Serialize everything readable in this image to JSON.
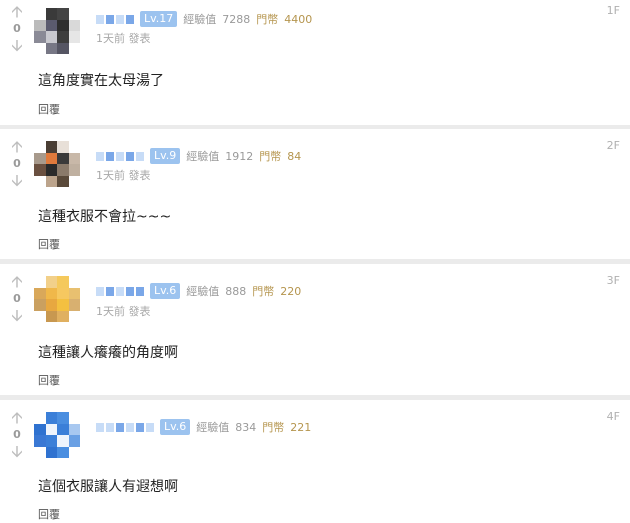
{
  "comments": [
    {
      "floor": "1F",
      "votes": "0",
      "level": "Lv.17",
      "exp_label": "經驗值",
      "exp": "7288",
      "coin_label": "門幣",
      "coins": "4400",
      "time": "1天前 發表",
      "text": "這角度實在太母湯了",
      "reply": "回覆",
      "avatar_colors": [
        "#ffffff",
        "#3a3a3a",
        "#444444",
        "#ffffff",
        "#bbbbbb",
        "#5b5b6e",
        "#2e2e2e",
        "#d9d9d9",
        "#8a8a96",
        "#c9c9cf",
        "#3d3d3d",
        "#e6e6e6",
        "#ffffff",
        "#777785",
        "#555563",
        "#ffffff"
      ]
    },
    {
      "floor": "2F",
      "votes": "0",
      "level": "Lv.9",
      "exp_label": "經驗值",
      "exp": "1912",
      "coin_label": "門幣",
      "coins": "84",
      "time": "1天前 發表",
      "text": "這種衣服不會拉~~~",
      "reply": "回覆",
      "avatar_colors": [
        "#ffffff",
        "#4a3e34",
        "#e8e0d8",
        "#ffffff",
        "#a89a8c",
        "#e07a3c",
        "#3a3a3a",
        "#c8b8a8",
        "#6a5040",
        "#2a2a2a",
        "#8a7a6a",
        "#bfb0a0",
        "#ffffff",
        "#bca48c",
        "#5a4a3a",
        "#ffffff"
      ]
    },
    {
      "floor": "3F",
      "votes": "0",
      "level": "Lv.6",
      "exp_label": "經驗值",
      "exp": "888",
      "coin_label": "門幣",
      "coins": "220",
      "time": "1天前 發表",
      "text": "這種讓人癢癢的角度啊",
      "reply": "回覆",
      "avatar_colors": [
        "#ffffff",
        "#f2d08a",
        "#f5c95c",
        "#ffffff",
        "#d9a85a",
        "#f0b84a",
        "#f6c860",
        "#e8c070",
        "#caa060",
        "#e8a840",
        "#f4c040",
        "#d8b070",
        "#ffffff",
        "#c89850",
        "#e0b060",
        "#ffffff"
      ]
    },
    {
      "floor": "4F",
      "votes": "0",
      "level": "Lv.6",
      "exp_label": "經驗值",
      "exp": "834",
      "coin_label": "門幣",
      "coins": "221",
      "time": "",
      "text": "這個衣服讓人有遐想啊",
      "reply": "回覆",
      "avatar_colors": [
        "#ffffff",
        "#3b7fd8",
        "#4a8ee0",
        "#ffffff",
        "#2f72d0",
        "#eef4fc",
        "#3b7fd8",
        "#a8c8f0",
        "#3a78d4",
        "#3b7fd8",
        "#eef4fc",
        "#6aa0e4",
        "#ffffff",
        "#2f72d0",
        "#4a8ee0",
        "#ffffff"
      ]
    }
  ]
}
